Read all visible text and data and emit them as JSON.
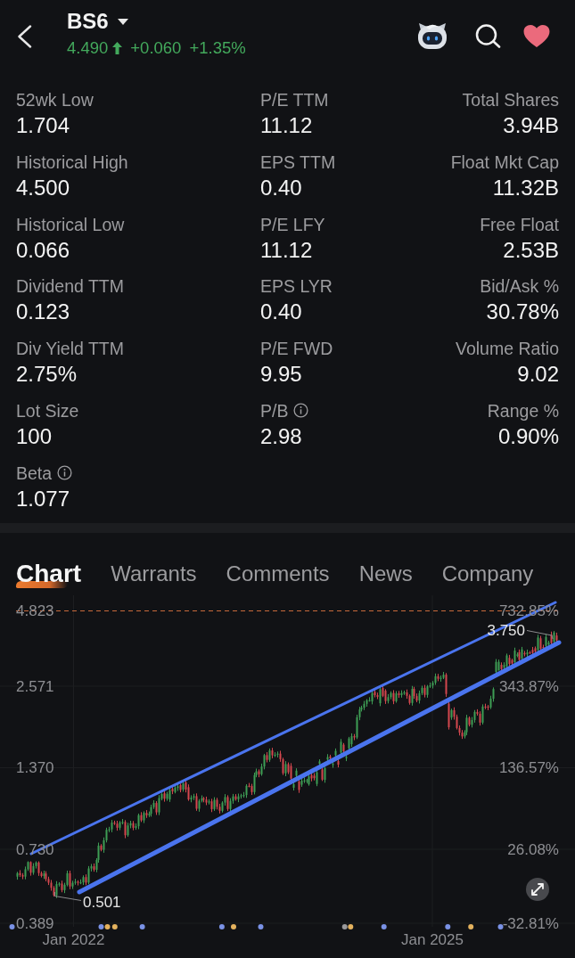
{
  "header": {
    "symbol": "BS6",
    "price": "4.490",
    "change": "+0.060",
    "change_percent": "+1.35%",
    "rising": true,
    "favorited": true
  },
  "stats": [
    [
      {
        "label": "52wk Low",
        "value": "1.704",
        "info": false
      },
      {
        "label": "P/E TTM",
        "value": "11.12",
        "info": false
      },
      {
        "label": "Total Shares",
        "value": "3.94B",
        "info": false
      }
    ],
    [
      {
        "label": "Historical High",
        "value": "4.500",
        "info": false
      },
      {
        "label": "EPS TTM",
        "value": "0.40",
        "info": false
      },
      {
        "label": "Float Mkt Cap",
        "value": "11.32B",
        "info": false
      }
    ],
    [
      {
        "label": "Historical Low",
        "value": "0.066",
        "info": false
      },
      {
        "label": "P/E LFY",
        "value": "11.12",
        "info": false
      },
      {
        "label": "Free Float",
        "value": "2.53B",
        "info": false
      }
    ],
    [
      {
        "label": "Dividend TTM",
        "value": "0.123",
        "info": false
      },
      {
        "label": "EPS LYR",
        "value": "0.40",
        "info": false
      },
      {
        "label": "Bid/Ask %",
        "value": "30.78%",
        "info": false
      }
    ],
    [
      {
        "label": "Div Yield TTM",
        "value": "2.75%",
        "info": false
      },
      {
        "label": "P/E FWD",
        "value": "9.95",
        "info": false
      },
      {
        "label": "Volume Ratio",
        "value": "9.02",
        "info": false
      }
    ],
    [
      {
        "label": "Lot Size",
        "value": "100",
        "info": false
      },
      {
        "label": "P/B",
        "value": "2.98",
        "info": true
      },
      {
        "label": "Range %",
        "value": "0.90%",
        "info": false
      }
    ],
    [
      {
        "label": "Beta",
        "value": "1.077",
        "info": true
      }
    ]
  ],
  "tabs": [
    {
      "label": "Chart",
      "selected": true
    },
    {
      "label": "Warrants",
      "selected": false
    },
    {
      "label": "Comments",
      "selected": false
    },
    {
      "label": "News",
      "selected": false
    },
    {
      "label": "Company",
      "selected": false
    }
  ],
  "chart": {
    "price_labels": [
      "4.823",
      "2.571",
      "1.370",
      "0.730",
      "0.389"
    ],
    "percent_labels": [
      "732.85%",
      "343.87%",
      "136.57%",
      "26.08%",
      "-32.81%"
    ],
    "date_labels": [
      "Jan 2022",
      "Jan 2025"
    ],
    "high_marker": "3.750",
    "low_marker": "0.501",
    "events": [
      {
        "color": "#7a92e6"
      },
      {
        "color": "#7a92e6"
      },
      {
        "color": "#e4b25e"
      },
      {
        "color": "#e4b25e"
      },
      {
        "color": "#7a92e6"
      },
      {
        "color": "#7a92e6"
      },
      {
        "color": "#e4b25e"
      },
      {
        "color": "#7a92e6"
      },
      {
        "color": "#9a9a9c"
      },
      {
        "color": "#e4b25e"
      },
      {
        "color": "#7a92e6"
      },
      {
        "color": "#7a92e6"
      },
      {
        "color": "#e4b25e"
      },
      {
        "color": "#7a92e6"
      }
    ]
  }
}
